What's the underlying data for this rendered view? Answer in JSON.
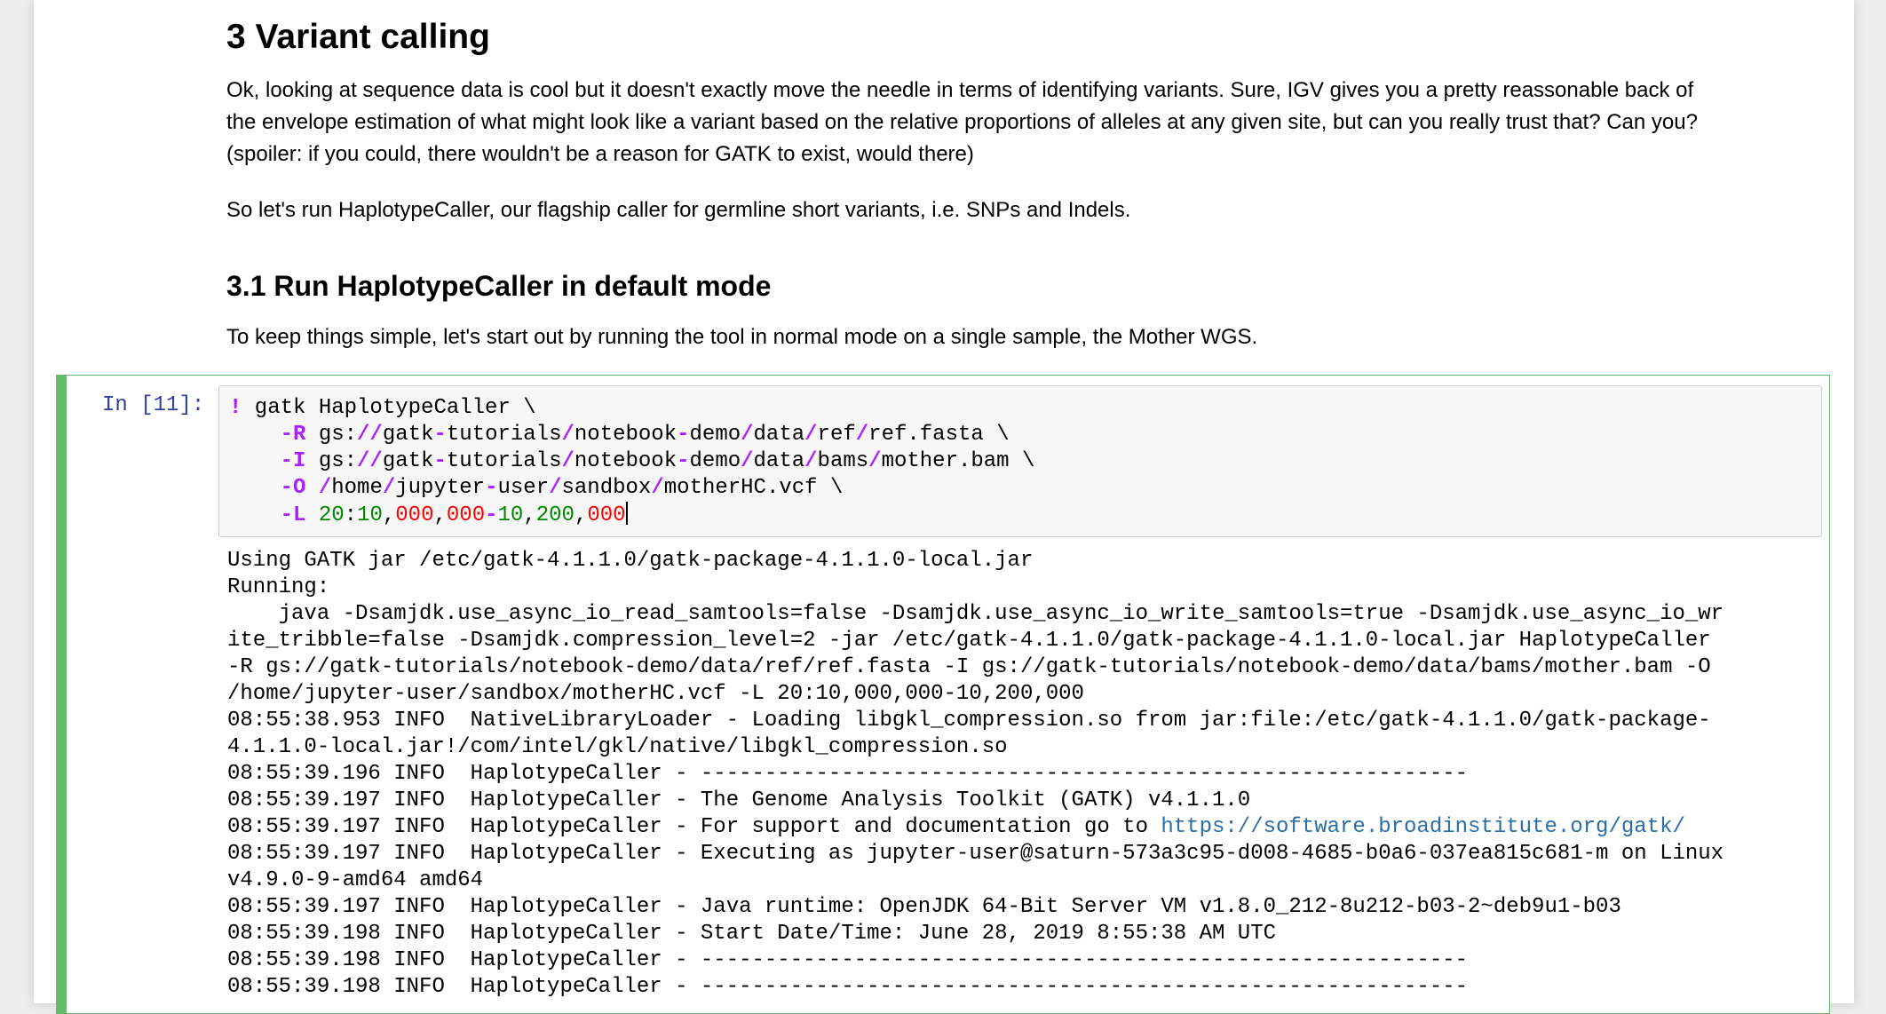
{
  "section": {
    "title": "3  Variant calling",
    "para1_lines": [
      "Ok, looking at sequence data is cool but it doesn't exactly move the needle in terms of identifying variants. Sure, IGV gives you a pretty reassonable back of",
      "the envelope estimation of what might look like a variant based on the relative proportions of alleles at any given site, but can you really trust that? Can you?",
      "(spoiler: if you could, there wouldn't be a reason for GATK to exist, would there)"
    ],
    "para2": "So let's run HaplotypeCaller, our flagship caller for germline short variants, i.e. SNPs and Indels."
  },
  "subsection": {
    "title": "3.1  Run HaplotypeCaller in default mode",
    "para": "To keep things simple, let's start out by running the tool in normal mode on a single sample, the Mother WGS."
  },
  "cell": {
    "prompt": "In [11]:",
    "code": {
      "bang": "!",
      "line1": " gatk HaplotypeCaller \\",
      "r_flag": "-R",
      "r_path": [
        " gs:",
        "//",
        "gatk",
        "-",
        "tutorials",
        "/",
        "notebook",
        "-",
        "demo",
        "/",
        "data",
        "/",
        "ref",
        "/",
        "ref.fasta \\"
      ],
      "i_flag": "-I",
      "i_path": [
        " gs:",
        "//",
        "gatk",
        "-",
        "tutorials",
        "/",
        "notebook",
        "-",
        "demo",
        "/",
        "data",
        "/",
        "bams",
        "/",
        "mother.bam \\"
      ],
      "o_flag": "-O",
      "o_path": [
        " ",
        "/",
        "home",
        "/",
        "jupyter",
        "-",
        "user",
        "/",
        "sandbox",
        "/",
        "motherHC.vcf \\"
      ],
      "l_flag": "-L",
      "l_parts": [
        " ",
        "20",
        ":",
        "10",
        ",",
        "000",
        ",",
        "000",
        "-",
        "10",
        ",",
        "200",
        ",",
        "000"
      ]
    },
    "output": {
      "lines_before_link": [
        "Using GATK jar /etc/gatk-4.1.1.0/gatk-package-4.1.1.0-local.jar",
        "Running:",
        "    java -Dsamjdk.use_async_io_read_samtools=false -Dsamjdk.use_async_io_write_samtools=true -Dsamjdk.use_async_io_wr",
        "ite_tribble=false -Dsamjdk.compression_level=2 -jar /etc/gatk-4.1.1.0/gatk-package-4.1.1.0-local.jar HaplotypeCaller",
        "-R gs://gatk-tutorials/notebook-demo/data/ref/ref.fasta -I gs://gatk-tutorials/notebook-demo/data/bams/mother.bam -O",
        "/home/jupyter-user/sandbox/motherHC.vcf -L 20:10,000,000-10,200,000",
        "08:55:38.953 INFO  NativeLibraryLoader - Loading libgkl_compression.so from jar:file:/etc/gatk-4.1.1.0/gatk-package-",
        "4.1.1.0-local.jar!/com/intel/gkl/native/libgkl_compression.so",
        "08:55:39.196 INFO  HaplotypeCaller - ------------------------------------------------------------",
        "08:55:39.197 INFO  HaplotypeCaller - The Genome Analysis Toolkit (GATK) v4.1.1.0"
      ],
      "link_line_prefix": "08:55:39.197 INFO  HaplotypeCaller - For support and documentation go to ",
      "link_text": "https://software.broadinstitute.org/gatk/",
      "lines_after_link": [
        "08:55:39.197 INFO  HaplotypeCaller - Executing as jupyter-user@saturn-573a3c95-d008-4685-b0a6-037ea815c681-m on Linux",
        "v4.9.0-9-amd64 amd64",
        "08:55:39.197 INFO  HaplotypeCaller - Java runtime: OpenJDK 64-Bit Server VM v1.8.0_212-8u212-b03-2~deb9u1-b03",
        "08:55:39.198 INFO  HaplotypeCaller - Start Date/Time: June 28, 2019 8:55:38 AM UTC",
        "08:55:39.198 INFO  HaplotypeCaller - ------------------------------------------------------------",
        "08:55:39.198 INFO  HaplotypeCaller - ------------------------------------------------------------"
      ]
    }
  },
  "colors": {
    "cell_border": "#66bb6a",
    "prompt": "#303f9f",
    "operator": "#aa22ff",
    "number": "#008800",
    "zero_number": "#ff0000",
    "link": "#296eaa"
  }
}
